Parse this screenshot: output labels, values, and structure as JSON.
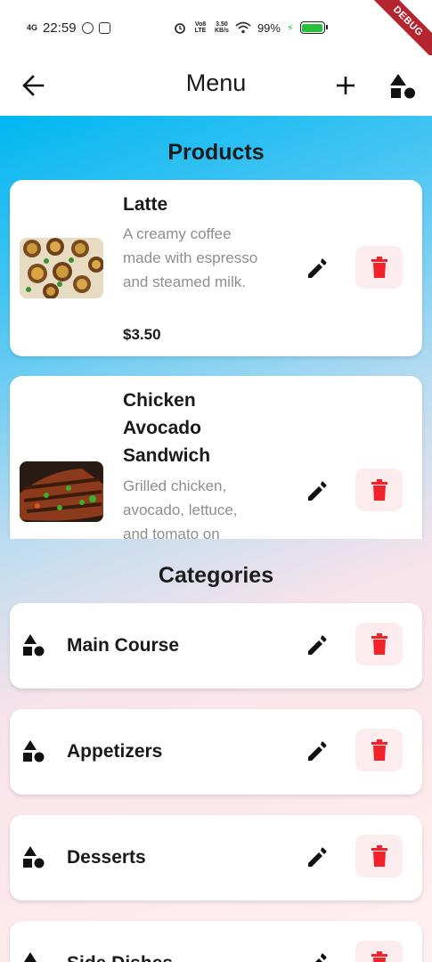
{
  "status_bar": {
    "network": "4G",
    "time": "22:59",
    "volte": "Vo8 LTE",
    "speed_top": "3.50",
    "speed_bottom": "KB/s",
    "battery_pct": "99%",
    "battery_level": 0.99,
    "debug_label": "DEBUG"
  },
  "app_bar": {
    "title": "Menu",
    "back_icon": "arrow-left-icon",
    "add_icon": "plus-icon",
    "categories_icon": "shapes-icon"
  },
  "products": {
    "title": "Products",
    "items": [
      {
        "name": "Latte",
        "description": "A creamy coffee made with espresso and steamed milk.",
        "price": "$3.50"
      },
      {
        "name": "Chicken Avocado Sandwich",
        "description": "Grilled chicken, avocado, lettuce, and tomato on",
        "price": ""
      }
    ]
  },
  "categories": {
    "title": "Categories",
    "items": [
      {
        "name": "Main Course"
      },
      {
        "name": "Appetizers"
      },
      {
        "name": "Desserts"
      },
      {
        "name": "Side Dishes"
      }
    ]
  },
  "colors": {
    "delete_red": "#f0232a",
    "delete_bg": "#fdeced",
    "gradient_top": "#00b7f1",
    "gradient_bottom": "#fdf0f2"
  }
}
